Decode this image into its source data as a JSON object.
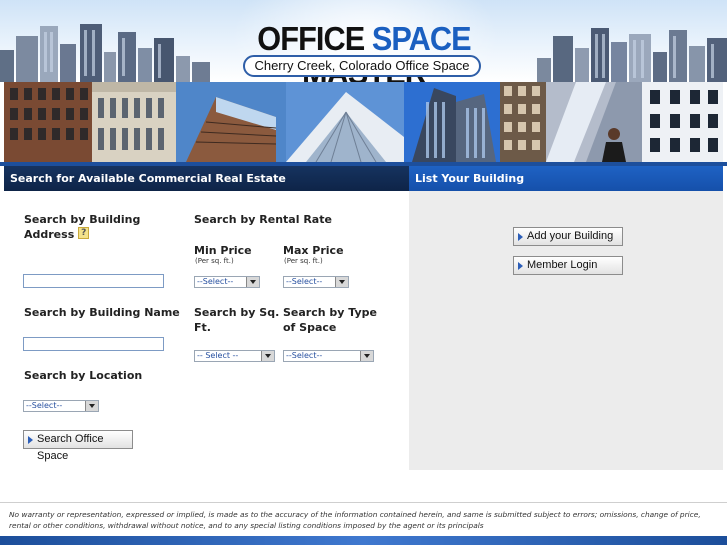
{
  "header": {
    "logo_part1": "OFFICE",
    "logo_part2": "SPACE",
    "logo_part3": "MASTER",
    "tagline": "Cherry Creek, Colorado Office  Space"
  },
  "search_panel": {
    "title": "Search for Available Commercial Real Estate",
    "address_label_line1": "Search by Building",
    "address_label_line2": "Address",
    "help_glyph": "?",
    "address_value": "",
    "name_label": "Search by Building Name",
    "name_value": "",
    "location_label": "Search by Location",
    "location_select": "--Select--",
    "search_button": "Search Office Space",
    "rental_label": "Search by Rental Rate",
    "min_price_label": "Min Price",
    "min_price_unit": "(Per sq. ft.)",
    "min_price_select": "--Select--",
    "max_price_label": "Max Price",
    "max_price_unit": "(Per sq. ft.)",
    "max_price_select": "--Select--",
    "sqft_label_line1": "Search by Sq.",
    "sqft_label_line2": "Ft.",
    "sqft_select": "-- Select --",
    "type_label_line1": "Search by Type",
    "type_label_line2": "of Space",
    "type_select": "--Select--"
  },
  "list_panel": {
    "title": "List Your Building",
    "add_button": "Add your Building",
    "login_button": "Member Login"
  },
  "footer": {
    "disclaimer": "No warranty or representation, expressed or implied, is made as to the accuracy of the information contained herein, and same is submitted subject to errors; omissions, change of price, rental or other conditions, withdrawal without notice, and to any special listing conditions imposed by the agent or its principals"
  },
  "colors": {
    "logo_blue": "#1a5fc0",
    "search_header": "#16335f",
    "list_header": "#1f62c4",
    "right_panel_bg": "#ececec"
  }
}
